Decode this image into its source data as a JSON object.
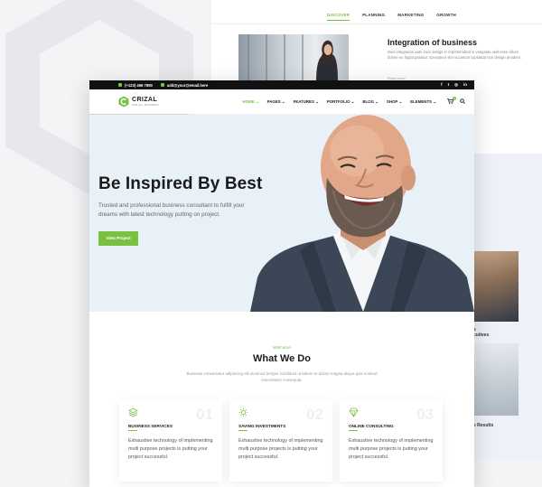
{
  "back_page": {
    "tabs": [
      "DISCOVER",
      "PLANNING",
      "MARKETING",
      "GROWTH"
    ],
    "title": "Integration of business",
    "text": "Duis integration aute irure design in reprehenderit in voluptate velit esse cillum dolore eu fugiat pariatur. Excepteur sint occaecat cupidatat non design proident.",
    "small": "Read more"
  },
  "side": {
    "label1a": "s",
    "label1b": "cutives",
    "label2": "e Results"
  },
  "topbar": {
    "phone": "(+123) 456 7890",
    "email": "add@your@email.here",
    "socials": [
      "f",
      "t",
      "◎",
      "in"
    ]
  },
  "logo": {
    "name": "CRIZAL",
    "tagline": "FOR ALL BUSINESS"
  },
  "menu": [
    "HOME ⌄",
    "PAGES ⌄",
    "FEATURES ⌄",
    "PORTFOLIO ⌄",
    "BLOG ⌄",
    "SHOP ⌄",
    "ELEMENTS ⌄"
  ],
  "cart_count": "0",
  "hero": {
    "title": "Be Inspired By Best",
    "text": "Trusted and professional business consultant to fulfill your dreams with latest technology putting on project.",
    "button": "View Project"
  },
  "section": {
    "welcome": "Welcome",
    "title": "What We Do",
    "subtitle": "Business consectetur adipiscing elit eiusmod tempor incididunt ut labore et dolore magna aliqua quis nostrud exercitation consequat."
  },
  "cards": [
    {
      "title": "BUSINESS SERVICES",
      "number": "01",
      "text": "Exhaustive technology of implementing multi purpose projects is putting your project successful."
    },
    {
      "title": "SAVING INVESTMENTS",
      "number": "02",
      "text": "Exhaustive technology of implementing multi purpose projects is putting your project successful."
    },
    {
      "title": "ONLINE CONSULTING",
      "number": "03",
      "text": "Exhaustive technology of implementing multi purpose projects is putting your project successful."
    }
  ],
  "colors": {
    "accent": "#7ac142",
    "topbar": "#111111",
    "hero_bg": "#e8f0f8"
  }
}
